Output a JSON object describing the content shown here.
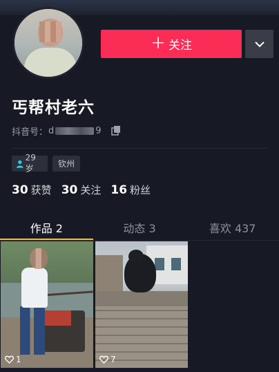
{
  "profile": {
    "name": "丐帮村老六",
    "douyin_id_label": "抖音号：",
    "douyin_id_prefix": "d",
    "douyin_id_suffix": "9"
  },
  "actions": {
    "follow_plus": "＋",
    "follow_label": "关注"
  },
  "tags": {
    "age": "29岁",
    "city": "钦州"
  },
  "stats": [
    {
      "num": "30",
      "label": "获赞"
    },
    {
      "num": "30",
      "label": "关注"
    },
    {
      "num": "16",
      "label": "粉丝"
    }
  ],
  "tabs": [
    {
      "label": "作品 2",
      "active": true
    },
    {
      "label": "动态 3",
      "active": false
    },
    {
      "label": "喜欢 437",
      "active": false
    }
  ],
  "videos": [
    {
      "likes": "1"
    },
    {
      "likes": "7"
    }
  ],
  "colors": {
    "accent": "#fb2c55",
    "tab_indicator": "#f4c41a",
    "background": "#171a24"
  }
}
